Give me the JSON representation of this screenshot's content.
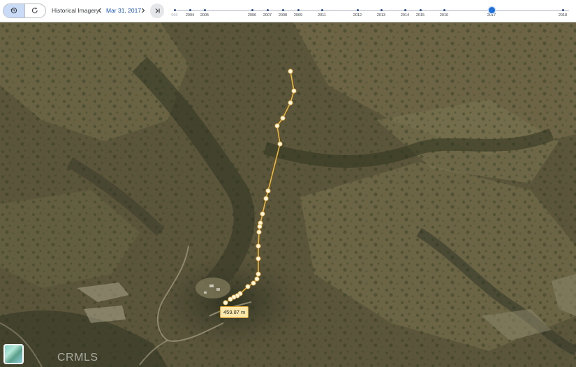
{
  "toolbar": {
    "history_icon": "history-back-icon",
    "redo_icon": "history-forward-icon",
    "title": "Historical Imagery",
    "date": "Mar 31, 2017",
    "prev_icon": "chevron-left-icon",
    "next_icon": "chevron-right-icon",
    "latest_icon": "skip-to-latest-icon"
  },
  "timeline": {
    "years": [
      {
        "label": "003",
        "faded": true
      },
      {
        "label": "2004"
      },
      {
        "label": "2005"
      },
      {
        "label": "2006"
      },
      {
        "label": "2007"
      },
      {
        "label": "2008"
      },
      {
        "label": "2009"
      },
      {
        "label": "2011"
      },
      {
        "label": "2012"
      },
      {
        "label": "2013"
      },
      {
        "label": "2014"
      },
      {
        "label": "2015"
      },
      {
        "label": "2016"
      },
      {
        "label": "2017"
      },
      {
        "label": "2018"
      }
    ],
    "selected_year": "2017"
  },
  "map": {
    "measurement_label": "459.87 m",
    "path_color": "#f0b63a",
    "watermark": "CRMLS",
    "layer_icon": "satellite-layer-thumbnail"
  }
}
